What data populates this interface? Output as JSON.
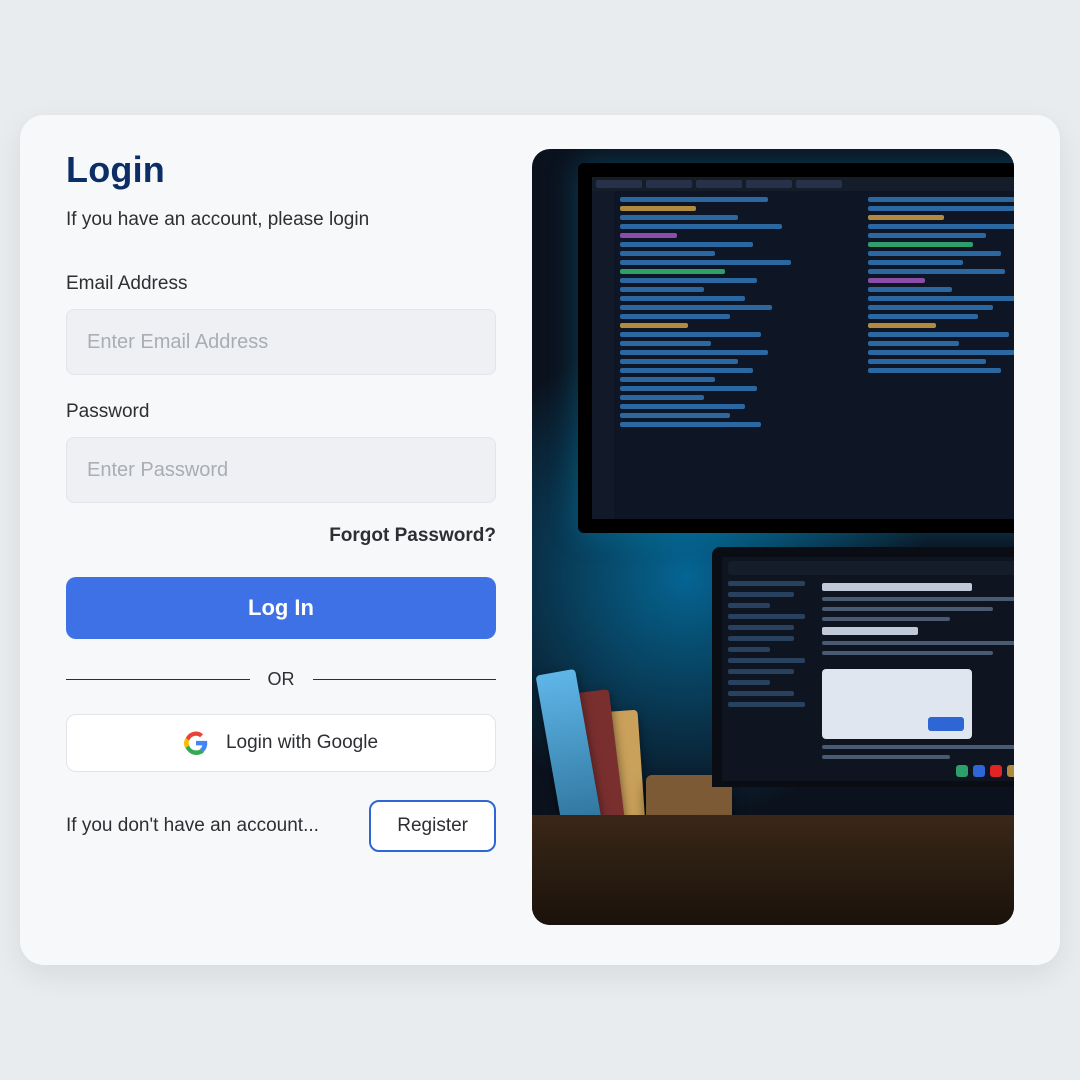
{
  "login": {
    "title": "Login",
    "subtitle": "If you have an account, please login",
    "email_label": "Email Address",
    "email_placeholder": "Enter Email Address",
    "email_value": "",
    "password_label": "Password",
    "password_placeholder": "Enter Password",
    "password_value": "",
    "forgot_label": "Forgot Password?",
    "submit_label": "Log In",
    "divider_label": "OR",
    "google_label": "Login with Google",
    "no_account_text": "If you don't have an account...",
    "register_label": "Register"
  },
  "colors": {
    "primary": "#3e71e6",
    "title": "#0b2e66",
    "outline": "#2f66d6"
  }
}
